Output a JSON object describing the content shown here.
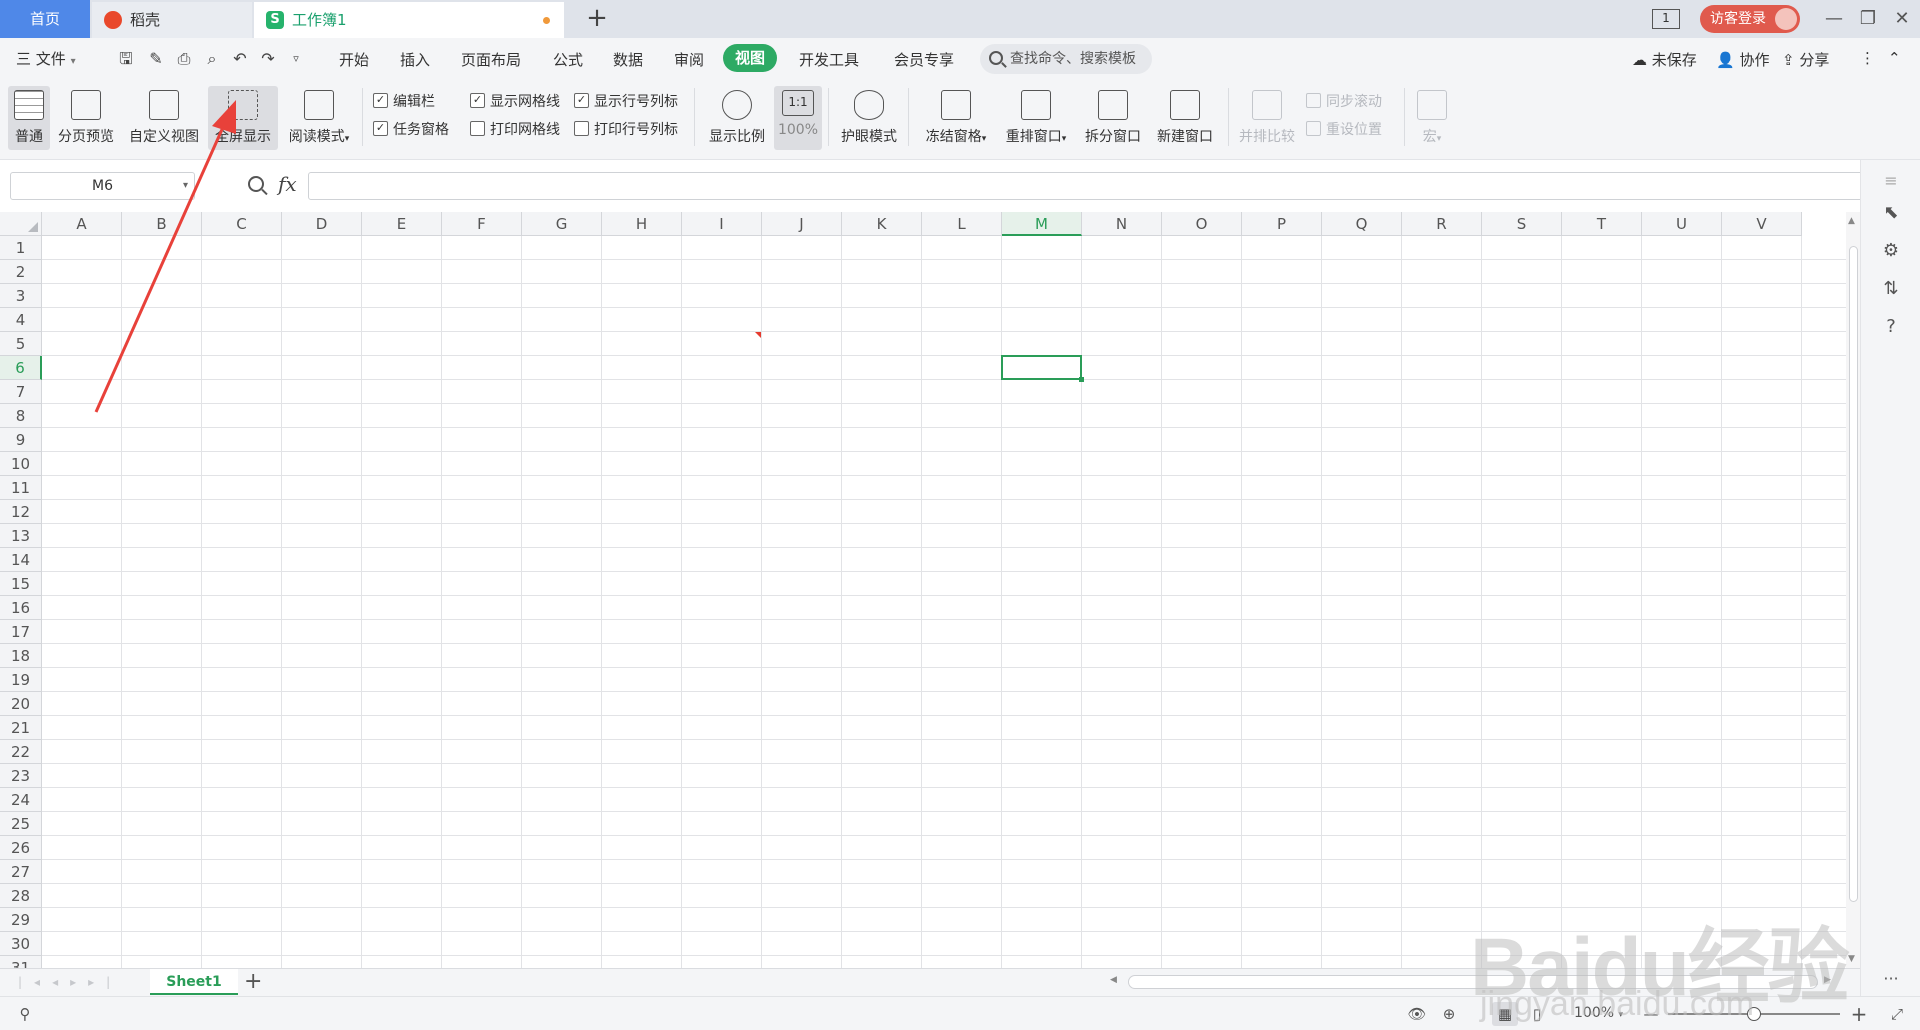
{
  "tabs": {
    "home": "首页",
    "daoke": "稻壳",
    "workbook": "工作簿1",
    "add": "+"
  },
  "window": {
    "page_indicator": "1",
    "login": "访客登录"
  },
  "menu": {
    "file": "三 文件",
    "items": [
      "开始",
      "插入",
      "页面布局",
      "公式",
      "数据",
      "审阅",
      "视图",
      "开发工具",
      "会员专享"
    ],
    "active": "视图",
    "search_placeholder": "查找命令、搜索模板",
    "right": [
      "未保存",
      "协作",
      "分享"
    ]
  },
  "ribbon": {
    "normal": "普通",
    "page_preview": "分页预览",
    "custom_view": "自定义视图",
    "fullscreen": "全屏显示",
    "reading_mode": "阅读模式",
    "checks": {
      "edit_bar": {
        "label": "编辑栏",
        "checked": true
      },
      "task_pane": {
        "label": "任务窗格",
        "checked": true
      },
      "show_grid": {
        "label": "显示网格线",
        "checked": true
      },
      "print_grid": {
        "label": "打印网格线",
        "checked": false
      },
      "show_headers": {
        "label": "显示行号列标",
        "checked": true
      },
      "print_headers": {
        "label": "打印行号列标",
        "checked": false
      }
    },
    "zoom_ratio": "显示比例",
    "zoom_100_icon": "1:1",
    "zoom_100": "100%",
    "eye_mode": "护眼模式",
    "freeze": "冻结窗格",
    "rearrange": "重排窗口",
    "split": "拆分窗口",
    "new_window": "新建窗口",
    "side_by_side": "并排比较",
    "sync_scroll": "同步滚动",
    "reset_position": "重设位置",
    "macro": "宏"
  },
  "formula_bar": {
    "name_box": "M6",
    "fx": "fx",
    "value": ""
  },
  "grid": {
    "columns": [
      "A",
      "B",
      "C",
      "D",
      "E",
      "F",
      "G",
      "H",
      "I",
      "J",
      "K",
      "L",
      "M",
      "N",
      "O",
      "P",
      "Q",
      "R",
      "S",
      "T",
      "U",
      "V"
    ],
    "rows": [
      "1",
      "2",
      "3",
      "4",
      "5",
      "6",
      "7",
      "8",
      "9",
      "10",
      "11",
      "12",
      "13",
      "14",
      "15",
      "16",
      "17",
      "18",
      "19",
      "20",
      "21",
      "22",
      "23",
      "24",
      "25",
      "26",
      "27",
      "28",
      "29",
      "30",
      "31"
    ],
    "selected_column": "M",
    "selected_row": "6"
  },
  "sheets": {
    "tabs": [
      "Sheet1"
    ],
    "active": "Sheet1",
    "add": "+"
  },
  "status": {
    "zoom": "100%",
    "zoom_fraction": 0.5
  },
  "watermark": {
    "brand": "Baidu经验",
    "url": "jingyan.baidu.com"
  },
  "colors": {
    "accent_green": "#2daa64",
    "home_tab": "#4f88e8",
    "login": "#e05a4d",
    "arrow": "#e8413a"
  },
  "icons": [
    "save-icon",
    "print-icon",
    "undo-icon",
    "redo-icon",
    "search-icon",
    "cloud-icon",
    "collaborate-icon",
    "share-icon",
    "eye-icon"
  ]
}
